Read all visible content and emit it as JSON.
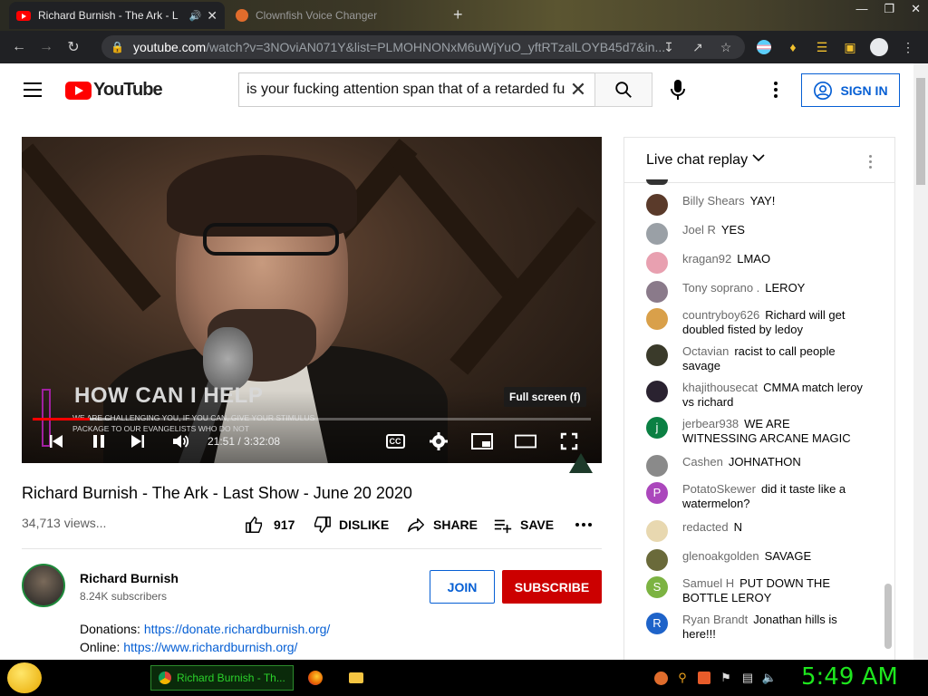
{
  "browser": {
    "tabs": [
      {
        "title": "Richard Burnish - The Ark - L",
        "active": true
      },
      {
        "title": "Clownfish Voice Changer",
        "active": false
      }
    ],
    "url_domain": "youtube.com",
    "url_rest": "/watch?v=3NOviAN071Y&list=PLMOHNONxM6uWjYuO_yftRTzalLOYB45d7&in..."
  },
  "youtube": {
    "logo_text": "YouTube",
    "search_query": "is your fucking attention span that of a retarded fu",
    "sign_in_label": "SIGN IN"
  },
  "video": {
    "overlay_title": "HOW CAN I HELP",
    "overlay_subtitle": "WE ARE CHALLENGING YOU, IF YOU CAN, GIVE YOUR STIMULUS PACKAGE TO OUR EVANGELISTS WHO DO NOT",
    "tooltip": "Full screen (f)",
    "time_current": "21:51",
    "time_total": "3:32:08",
    "time_display": "21:51 / 3:32:08",
    "progress_fraction": 0.103,
    "cc_label": "CC",
    "title": "Richard Burnish - The Ark - Last Show - June 20 2020",
    "views": "34,713 views...",
    "likes": "917",
    "dislike_label": "DISLIKE",
    "share_label": "SHARE",
    "save_label": "SAVE"
  },
  "channel": {
    "name": "Richard Burnish",
    "subscribers": "8.24K subscribers",
    "join_label": "JOIN",
    "subscribe_label": "SUBSCRIBE",
    "donations_label": "Donations:",
    "donations_url": "https://donate.richardburnish.org/",
    "online_label": "Online:",
    "online_url": "https://www.richardburnish.org/"
  },
  "chat": {
    "header": "Live chat replay",
    "messages": [
      {
        "author": "Billy Shears",
        "text": "YAY!",
        "avatar_color": "#5a3a2a",
        "initial": ""
      },
      {
        "author": "Joel R",
        "text": "YES",
        "avatar_color": "#9aa0a6",
        "initial": ""
      },
      {
        "author": "kragan92",
        "text": "LMAO",
        "avatar_color": "#e8a0b0",
        "initial": ""
      },
      {
        "author": "Tony soprano .",
        "text": "LEROY",
        "avatar_color": "#8a7a8a",
        "initial": ""
      },
      {
        "author": "countryboy626",
        "text": "Richard will get doubled fisted by ledoy",
        "avatar_color": "#d9a04a",
        "initial": ""
      },
      {
        "author": "Octavian",
        "text": "racist to call people savage",
        "avatar_color": "#3a3a2a",
        "initial": ""
      },
      {
        "author": "khajithousecat",
        "text": "CMMA match leroy vs richard",
        "avatar_color": "#2a2230",
        "initial": ""
      },
      {
        "author": "jerbear938",
        "text": "WE ARE WITNESSING ARCANE MAGIC",
        "avatar_color": "#0b8043",
        "initial": "j"
      },
      {
        "author": "Cashen",
        "text": "JOHNATHON",
        "avatar_color": "#8a8a8a",
        "initial": ""
      },
      {
        "author": "PotatoSkewer",
        "text": "did it taste like a watermelon?",
        "avatar_color": "#ab47bc",
        "initial": "P"
      },
      {
        "author": "redacted",
        "text": "N",
        "avatar_color": "#e8d8b0",
        "initial": ""
      },
      {
        "author": "glenoakgolden",
        "text": "SAVAGE",
        "avatar_color": "#6a6a3a",
        "initial": ""
      },
      {
        "author": "Samuel H",
        "text": "PUT DOWN THE BOTTLE LEROY",
        "avatar_color": "#7cb342",
        "initial": "S"
      },
      {
        "author": "Ryan Brandt",
        "text": "Jonathan hills is here!!!",
        "avatar_color": "#1e63c9",
        "initial": "R"
      }
    ]
  },
  "taskbar": {
    "active_item": "Richard Burnish - Th...",
    "clock": "5:49 AM"
  }
}
